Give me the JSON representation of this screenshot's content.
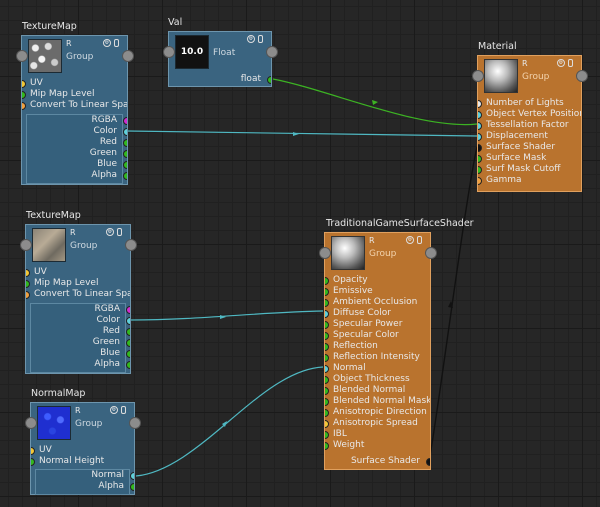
{
  "colors": {
    "yellow": "#f2c736",
    "green": "#32b81e",
    "cyan": "#5fd0da",
    "magenta": "#d02ccf",
    "black": "#111111",
    "orange_v": "#f0a040",
    "white": "#e8e8e8"
  },
  "nodes": {
    "tex1": {
      "title": "TextureMap",
      "r": "R",
      "sub": "Group",
      "inputs": [
        {
          "label": "UV",
          "c": "yellow"
        },
        {
          "label": "Mip Map Level",
          "c": "green"
        },
        {
          "label": "Convert To Linear Space",
          "c": "orange_v"
        }
      ],
      "outputs": [
        {
          "label": "RGBA",
          "c": "magenta"
        },
        {
          "label": "Color",
          "c": "cyan"
        },
        {
          "label": "Red",
          "c": "green"
        },
        {
          "label": "Green",
          "c": "green"
        },
        {
          "label": "Blue",
          "c": "green"
        },
        {
          "label": "Alpha",
          "c": "green"
        }
      ]
    },
    "val": {
      "title": "Val",
      "r": "",
      "sub": "Float",
      "thumb": "10.0",
      "outputs": [
        {
          "label": "float",
          "c": "green"
        }
      ]
    },
    "mat": {
      "title": "Material",
      "r": "R",
      "sub": "Group",
      "inputs": [
        {
          "label": "Number of Lights",
          "c": "white"
        },
        {
          "label": "Object Vertex Position",
          "c": "cyan"
        },
        {
          "label": "Tessellation Factor",
          "c": "cyan"
        },
        {
          "label": "Displacement",
          "c": "cyan"
        },
        {
          "label": "Surface Shader",
          "c": "black"
        },
        {
          "label": "Surface Mask",
          "c": "green"
        },
        {
          "label": "Surf Mask Cutoff",
          "c": "green"
        },
        {
          "label": "Gamma",
          "c": "orange_v"
        }
      ]
    },
    "tex2": {
      "title": "TextureMap",
      "r": "R",
      "sub": "Group",
      "inputs": [
        {
          "label": "UV",
          "c": "yellow"
        },
        {
          "label": "Mip Map Level",
          "c": "green"
        },
        {
          "label": "Convert To Linear Space",
          "c": "orange_v"
        }
      ],
      "outputs": [
        {
          "label": "RGBA",
          "c": "magenta"
        },
        {
          "label": "Color",
          "c": "cyan"
        },
        {
          "label": "Red",
          "c": "green"
        },
        {
          "label": "Green",
          "c": "green"
        },
        {
          "label": "Blue",
          "c": "green"
        },
        {
          "label": "Alpha",
          "c": "green"
        }
      ]
    },
    "tgs": {
      "title": "TraditionalGameSurfaceShader",
      "r": "R",
      "sub": "Group",
      "inputs": [
        {
          "label": "Opacity",
          "c": "green"
        },
        {
          "label": "Emissive",
          "c": "green"
        },
        {
          "label": "Ambient Occlusion",
          "c": "green"
        },
        {
          "label": "Diffuse Color",
          "c": "cyan"
        },
        {
          "label": "Specular Power",
          "c": "green"
        },
        {
          "label": "Specular Color",
          "c": "green"
        },
        {
          "label": "Reflection",
          "c": "green"
        },
        {
          "label": "Reflection Intensity",
          "c": "green"
        },
        {
          "label": "Normal",
          "c": "cyan"
        },
        {
          "label": "Object Thickness",
          "c": "green"
        },
        {
          "label": "Blended Normal",
          "c": "green"
        },
        {
          "label": "Blended Normal Mask",
          "c": "green"
        },
        {
          "label": "Anisotropic Direction",
          "c": "green"
        },
        {
          "label": "Anisotropic Spread",
          "c": "yellow"
        },
        {
          "label": "IBL",
          "c": "green"
        },
        {
          "label": "Weight",
          "c": "green"
        }
      ],
      "outputs": [
        {
          "label": "Surface Shader",
          "c": "black"
        }
      ]
    },
    "nrm": {
      "title": "NormalMap",
      "r": "R",
      "sub": "Group",
      "inputs": [
        {
          "label": "UV",
          "c": "yellow"
        },
        {
          "label": "Normal Height",
          "c": "green"
        }
      ],
      "outputs": [
        {
          "label": "Normal",
          "c": "cyan"
        },
        {
          "label": "Alpha",
          "c": "green"
        }
      ]
    }
  }
}
